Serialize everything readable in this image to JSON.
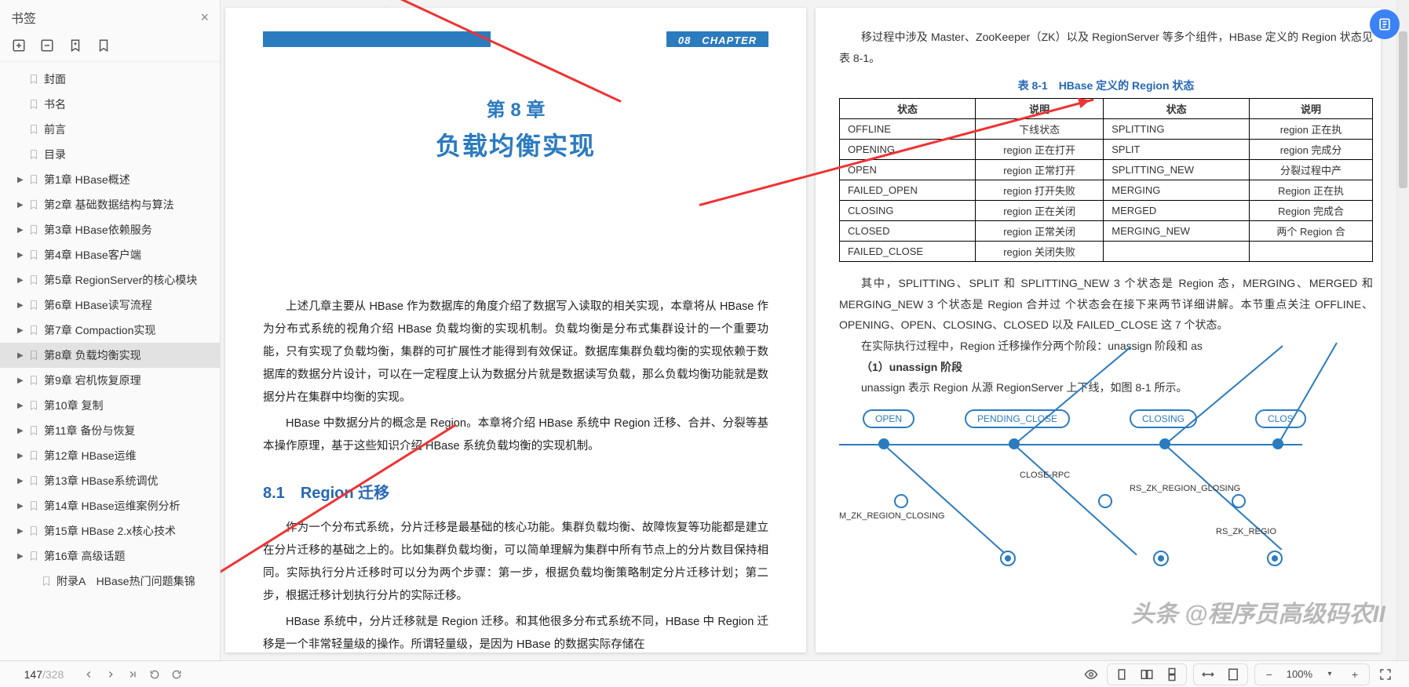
{
  "sidebar": {
    "title": "书签",
    "items": [
      {
        "label": "封面",
        "expandable": false
      },
      {
        "label": "书名",
        "expandable": false
      },
      {
        "label": "前言",
        "expandable": false
      },
      {
        "label": "目录",
        "expandable": false
      },
      {
        "label": "第1章 HBase概述",
        "expandable": true
      },
      {
        "label": "第2章 基础数据结构与算法",
        "expandable": true
      },
      {
        "label": "第3章 HBase依赖服务",
        "expandable": true
      },
      {
        "label": "第4章 HBase客户端",
        "expandable": true
      },
      {
        "label": "第5章 RegionServer的核心模块",
        "expandable": true
      },
      {
        "label": "第6章 HBase读写流程",
        "expandable": true
      },
      {
        "label": "第7章 Compaction实现",
        "expandable": true
      },
      {
        "label": "第8章 负载均衡实现",
        "expandable": true,
        "selected": true
      },
      {
        "label": "第9章 宕机恢复原理",
        "expandable": true
      },
      {
        "label": "第10章 复制",
        "expandable": true
      },
      {
        "label": "第11章 备份与恢复",
        "expandable": true
      },
      {
        "label": "第12章 HBase运维",
        "expandable": true
      },
      {
        "label": "第13章 HBase系统调优",
        "expandable": true
      },
      {
        "label": "第14章 HBase运维案例分析",
        "expandable": true
      },
      {
        "label": "第15章 HBase 2.x核心技术",
        "expandable": true
      },
      {
        "label": "第16章 高级话题",
        "expandable": true
      },
      {
        "label": "附录A　HBase热门问题集锦",
        "expandable": false,
        "child": true
      }
    ]
  },
  "leftPage": {
    "chapterBadge": "08　CHAPTER",
    "chapterNum": "第 8 章",
    "chapterTitle": "负载均衡实现",
    "para1": "上述几章主要从 HBase 作为数据库的角度介绍了数据写入读取的相关实现，本章将从 HBase 作为分布式系统的视角介绍 HBase 负载均衡的实现机制。负载均衡是分布式集群设计的一个重要功能，只有实现了负载均衡，集群的可扩展性才能得到有效保证。数据库集群负载均衡的实现依赖于数据库的数据分片设计，可以在一定程度上认为数据分片就是数据读写负载，那么负载均衡功能就是数据分片在集群中均衡的实现。",
    "para2": "HBase 中数据分片的概念是 Region。本章将介绍 HBase 系统中 Region 迁移、合并、分裂等基本操作原理，基于这些知识介绍 HBase 系统负载均衡的实现机制。",
    "sectionNum": "8.1",
    "sectionTitle": "Region 迁移",
    "para3": "作为一个分布式系统，分片迁移是最基础的核心功能。集群负载均衡、故障恢复等功能都是建立在分片迁移的基础之上的。比如集群负载均衡，可以简单理解为集群中所有节点上的分片数目保持相同。实际执行分片迁移时可以分为两个步骤：第一步，根据负载均衡策略制定分片迁移计划；第二步，根据迁移计划执行分片的实际迁移。",
    "para4": "HBase 系统中，分片迁移就是 Region 迁移。和其他很多分布式系统不同，HBase 中 Region 迁移是一个非常轻量级的操作。所谓轻量级，是因为 HBase 的数据实际存储在"
  },
  "rightPage": {
    "topPara": "移过程中涉及 Master、ZooKeeper（ZK）以及 RegionServer 等多个组件，HBase 定义的 Region 状态见表 8-1。",
    "tableCaption": "表 8-1　HBase 定义的 Region 状态",
    "tableHeaders": [
      "状态",
      "说明",
      "状态",
      "说明"
    ],
    "tableRows": [
      [
        "OFFLINE",
        "下线状态",
        "SPLITTING",
        "region 正在执"
      ],
      [
        "OPENING",
        "region 正在打开",
        "SPLIT",
        "region 完成分"
      ],
      [
        "OPEN",
        "region 正常打开",
        "SPLITTING_NEW",
        "分裂过程中产"
      ],
      [
        "FAILED_OPEN",
        "region 打开失败",
        "MERGING",
        "Region 正在执"
      ],
      [
        "CLOSING",
        "region 正在关闭",
        "MERGED",
        "Region 完成合"
      ],
      [
        "CLOSED",
        "region 正常关闭",
        "MERGING_NEW",
        "两个 Region 合"
      ],
      [
        "FAILED_CLOSE",
        "region 关闭失败",
        "",
        ""
      ]
    ],
    "para1": "其中，SPLITTING、SPLIT 和 SPLITTING_NEW 3 个状态是 Region 态，MERGING、MERGED 和 MERGING_NEW 3 个状态是 Region 合并过 个状态会在接下来两节详细讲解。本节重点关注 OFFLINE、OPENING、OPEN、CLOSING、CLOSED 以及 FAILED_CLOSE 这 7 个状态。",
    "para2": "在实际执行过程中，Region 迁移操作分两个阶段：unassign 阶段和 as",
    "stage": "（1）unassign 阶段",
    "para3": "unassign 表示 Region 从源 RegionServer 上下线，如图 8-1 所示。",
    "diagram": {
      "nodes": [
        "OPEN",
        "PENDING_CLOSE",
        "CLOSING",
        "CLOS"
      ],
      "labels": [
        "CLOSE-RPC",
        "RS_ZK_REGION_GLOSING",
        "M_ZK_REGION_CLOSING",
        "RS_ZK_REGIO"
      ]
    }
  },
  "bottombar": {
    "page": "147",
    "total": "/328",
    "zoom": "100%"
  },
  "watermark": "头条 @程序员高级码农II"
}
